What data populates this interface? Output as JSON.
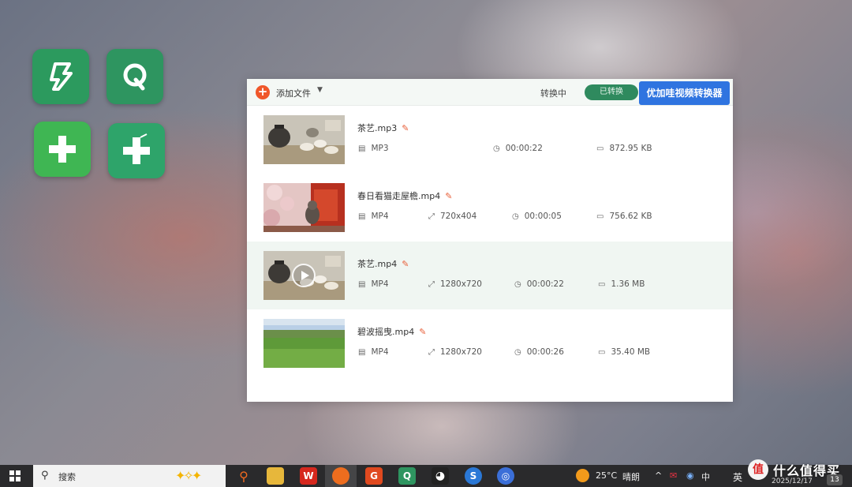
{
  "desktop": {
    "icons": [
      "video-logo-icon",
      "q-logo-icon",
      "green-plus-icon",
      "green-plus-gradient-icon"
    ]
  },
  "app": {
    "toolbar": {
      "add_file_label": "添加文件",
      "status_label": "转换中",
      "converted_label": "已转换",
      "brand_label": "优加哇视频转换器"
    },
    "files": [
      {
        "name": "茶艺.mp3",
        "format": "MP3",
        "resolution": "",
        "duration": "00:00:22",
        "size": "872.95 KB"
      },
      {
        "name": "春日看猫走屋檐.mp4",
        "format": "MP4",
        "resolution": "720x404",
        "duration": "00:00:05",
        "size": "756.62 KB"
      },
      {
        "name": "茶艺.mp4",
        "format": "MP4",
        "resolution": "1280x720",
        "duration": "00:00:22",
        "size": "1.36 MB"
      },
      {
        "name": "碧波摇曳.mp4",
        "format": "MP4",
        "resolution": "1280x720",
        "duration": "00:00:26",
        "size": "35.40 MB"
      }
    ]
  },
  "taskbar": {
    "search_placeholder": "搜索",
    "weather": "25°C",
    "weather_desc": "晴朗",
    "ime_lang": "英",
    "ime_mode": "中",
    "date": "2025/12/17",
    "notification_count": "13"
  },
  "watermark": {
    "text": "什么值得买"
  },
  "colors": {
    "accent_blue": "#2f74e0",
    "converted_green": "#2f8a5e",
    "add_orange": "#f0572a"
  }
}
